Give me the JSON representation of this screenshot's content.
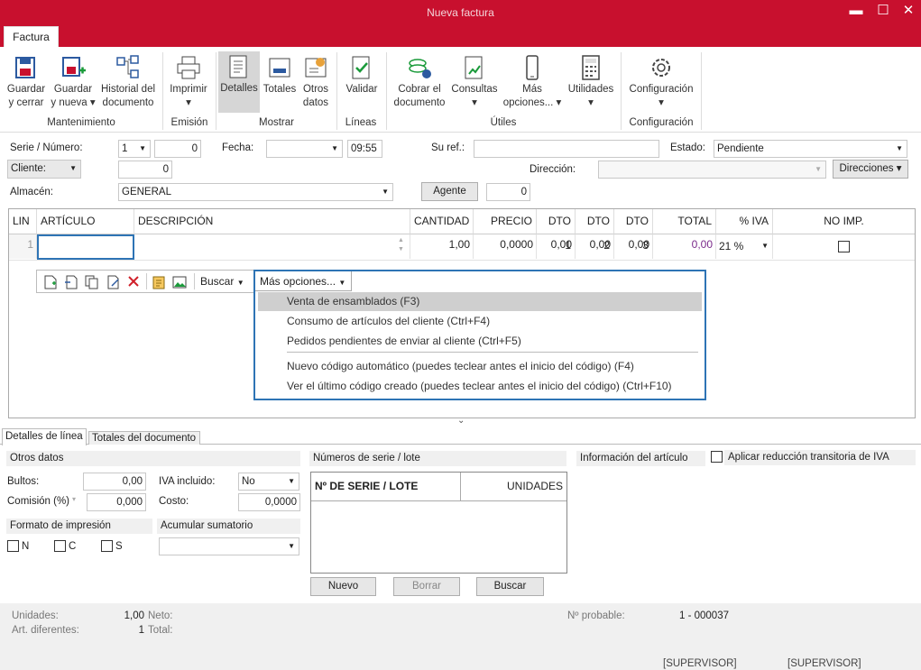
{
  "window": {
    "title": "Nueva factura",
    "minimize": "▬",
    "maximize": "☐",
    "close": "✕"
  },
  "tab": "Factura",
  "ribbon": {
    "buttons": {
      "guardar_cerrar": "Guardar y cerrar",
      "guardar_nueva": "Guardar y nueva ▾",
      "historial": "Historial del documento",
      "imprimir": "Imprimir ▾",
      "detalles": "Detalles",
      "totales": "Totales",
      "otros_datos": "Otros datos",
      "validar": "Validar",
      "cobrar": "Cobrar el documento",
      "consultas": "Consultas ▾",
      "mas_opciones": "Más opciones... ▾",
      "utilidades": "Utilidades ▾",
      "configuracion": "Configuración ▾"
    },
    "groups": {
      "mantenimiento": "Mantenimiento",
      "emision": "Emisión",
      "mostrar": "Mostrar",
      "lineas": "Líneas",
      "utiles": "Útiles",
      "configuracion": "Configuración"
    },
    "accent": "#c8102e"
  },
  "header": {
    "serie_label": "Serie / Número:",
    "serie_value": "1",
    "numero_value": "0",
    "fecha_label": "Fecha:",
    "fecha_value": "",
    "hora_value": "09:55",
    "suref_label": "Su ref.:",
    "suref_value": "",
    "estado_label": "Estado:",
    "estado_value": "Pendiente",
    "cliente_label": "Cliente:",
    "cliente_value": "0",
    "direccion_label": "Dirección:",
    "direccion_value": "",
    "direcciones_button": "Direcciones ▾",
    "almacen_label": "Almacén:",
    "almacen_value": "GENERAL",
    "agente_button": "Agente",
    "agente_value": "0"
  },
  "grid": {
    "columns": [
      "LIN",
      "ARTÍCULO",
      "DESCRIPCIÓN",
      "CANTIDAD",
      "PRECIO",
      "DTO 1",
      "DTO 2",
      "DTO 3",
      "TOTAL",
      "% IVA",
      "NO IMP."
    ],
    "rows": [
      {
        "lin": "1",
        "articulo": "",
        "descripcion": "",
        "cantidad": "1,00",
        "precio": "0,0000",
        "dto1": "0,00",
        "dto2": "0,00",
        "dto3": "0,00",
        "total": "0,00",
        "iva": "21 %"
      }
    ]
  },
  "line_toolbar": {
    "buscar": "Buscar",
    "mas_opciones": "Más opciones..."
  },
  "menu": {
    "items": [
      "Venta de ensamblados (F3)",
      "Consumo de artículos del cliente (Ctrl+F4)",
      "Pedidos pendientes de enviar al cliente (Ctrl+F5)",
      "Nuevo código automático (puedes teclear antes el inicio del código) (F4)",
      "Ver el último código creado (puedes teclear antes el inicio del código) (Ctrl+F10)"
    ]
  },
  "lower": {
    "tabs": [
      "Detalles de línea",
      "Totales del documento"
    ],
    "otros_datos": "Otros datos",
    "bultos_label": "Bultos:",
    "bultos_value": "0,00",
    "iva_incl_label": "IVA incluido:",
    "iva_incl_value": "No",
    "comision_label": "Comisión (%)",
    "comision_value": "0,000",
    "coste_label": "Costo:",
    "coste_value": "0,0000",
    "formato_label": "Formato de impresión",
    "acumular_label": "Acumular sumatorio",
    "formato_options": [
      "N",
      "C",
      "S"
    ],
    "serie_lote_title": "Números de serie / lote",
    "serie_lote_cols": [
      "Nº DE SERIE / LOTE",
      "UNIDADES"
    ],
    "nuevo": "Nuevo",
    "borrar": "Borrar",
    "buscar": "Buscar",
    "info_articulo": "Información del artículo",
    "aplicar_iva": "Aplicar reducción transitoria de IVA"
  },
  "footer": {
    "unidades_label": "Unidades:",
    "unidades_value": "1,00",
    "neto_label": "Neto:",
    "art_label": "Art. diferentes:",
    "art_value": "1",
    "total_label": "Total:",
    "probable_label": "Nº probable:",
    "probable_value": "1 - 000037",
    "user1": "[SUPERVISOR]",
    "user2": "[SUPERVISOR]"
  }
}
